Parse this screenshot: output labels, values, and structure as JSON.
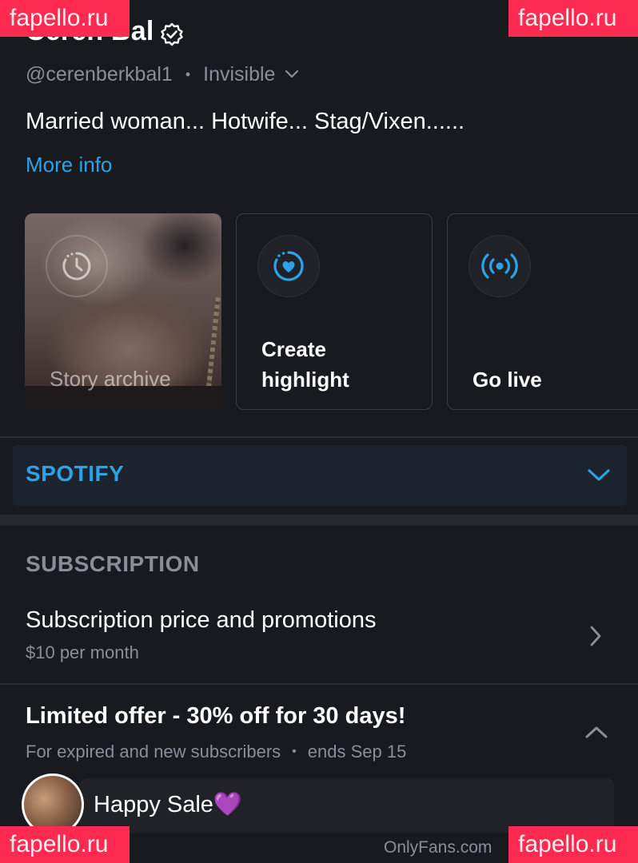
{
  "profile": {
    "name": "Ceren Bal",
    "handle": "@cerenberkbal1",
    "status": "Invisible",
    "bio": "Married woman... Hotwife... Stag/Vixen......",
    "more_info": "More info"
  },
  "story_cards": {
    "archive_label": "Story archive",
    "highlight_label_line1": "Create",
    "highlight_label_line2": "highlight",
    "live_label": "Go live"
  },
  "spotify": {
    "label": "SPOTIFY"
  },
  "subscription": {
    "heading": "SUBSCRIPTION",
    "price_title": "Subscription price and promotions",
    "price_value": "$10 per month",
    "offer_title": "Limited offer - 30% off for 30 days!",
    "offer_audience": "For expired and new subscribers",
    "offer_end": "ends Sep 15",
    "sale_message": "Happy Sale💜"
  },
  "footer": {
    "url": "OnlyFans.com"
  },
  "watermark": {
    "text": "fapello.ru"
  },
  "colors": {
    "accent": "#2ba3e6",
    "background": "#191a1f",
    "watermark_bg": "#ff2a4f",
    "muted_text": "#8a8e99"
  },
  "icons": [
    "verified-icon",
    "chevron-down-icon",
    "story-archive-icon",
    "highlight-heart-icon",
    "live-broadcast-icon",
    "chevron-right-icon",
    "chevron-up-icon"
  ]
}
